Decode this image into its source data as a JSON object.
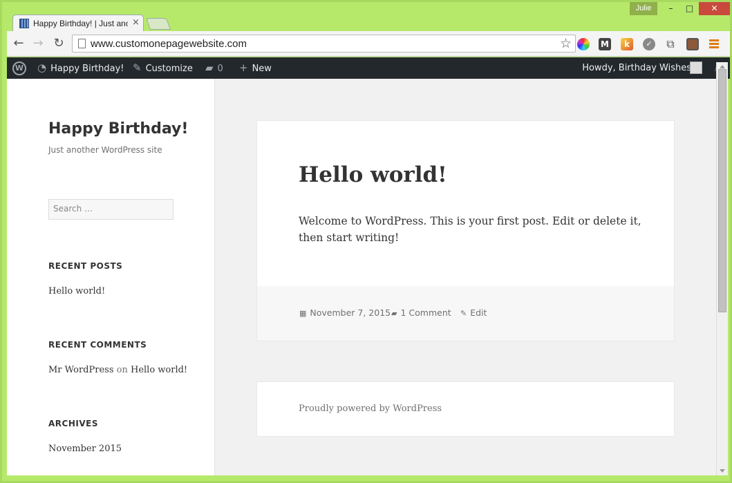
{
  "titlebar": {
    "user": "Julie",
    "minimize": "–",
    "maximize": "□",
    "close": "✕"
  },
  "tab": {
    "title": "Happy Birthday! | Just ano",
    "close": "×"
  },
  "toolbar": {
    "url": "www.customonepagewebsite.com",
    "back": "←",
    "forward": "→",
    "reload": "↻",
    "star": "☆"
  },
  "extensions": {
    "m_label": "M",
    "k_label": "k",
    "check_label": "✓",
    "puzzle_label": "⧉"
  },
  "adminbar": {
    "wp_logo": "W",
    "site_name": "Happy Birthday!",
    "customize": "Customize",
    "comments_count": "0",
    "new": "New",
    "howdy": "Howdy, Birthday Wishes",
    "icons": {
      "site": "◔",
      "customize": "✎",
      "comments": "▰",
      "new": "+",
      "search": "⌕"
    }
  },
  "sidebar": {
    "site_title": "Happy Birthday!",
    "site_description": "Just another WordPress site",
    "search_placeholder": "Search …",
    "recent_posts_title": "RECENT POSTS",
    "recent_posts": [
      "Hello world!"
    ],
    "recent_comments_title": "RECENT COMMENTS",
    "recent_comment": {
      "author": "Mr WordPress",
      "on": "on",
      "post": "Hello world!"
    },
    "archives_title": "ARCHIVES",
    "archives": [
      "November 2015"
    ]
  },
  "post": {
    "title": "Hello world!",
    "content": "Welcome to WordPress. This is your first post. Edit or delete it, then start writing!",
    "date": "November 7, 2015",
    "comments": "1 Comment",
    "edit": "Edit",
    "icons": {
      "date": "▦",
      "comments": "▰",
      "edit": "✎"
    }
  },
  "footer": {
    "powered_by": "Proudly powered by WordPress"
  }
}
